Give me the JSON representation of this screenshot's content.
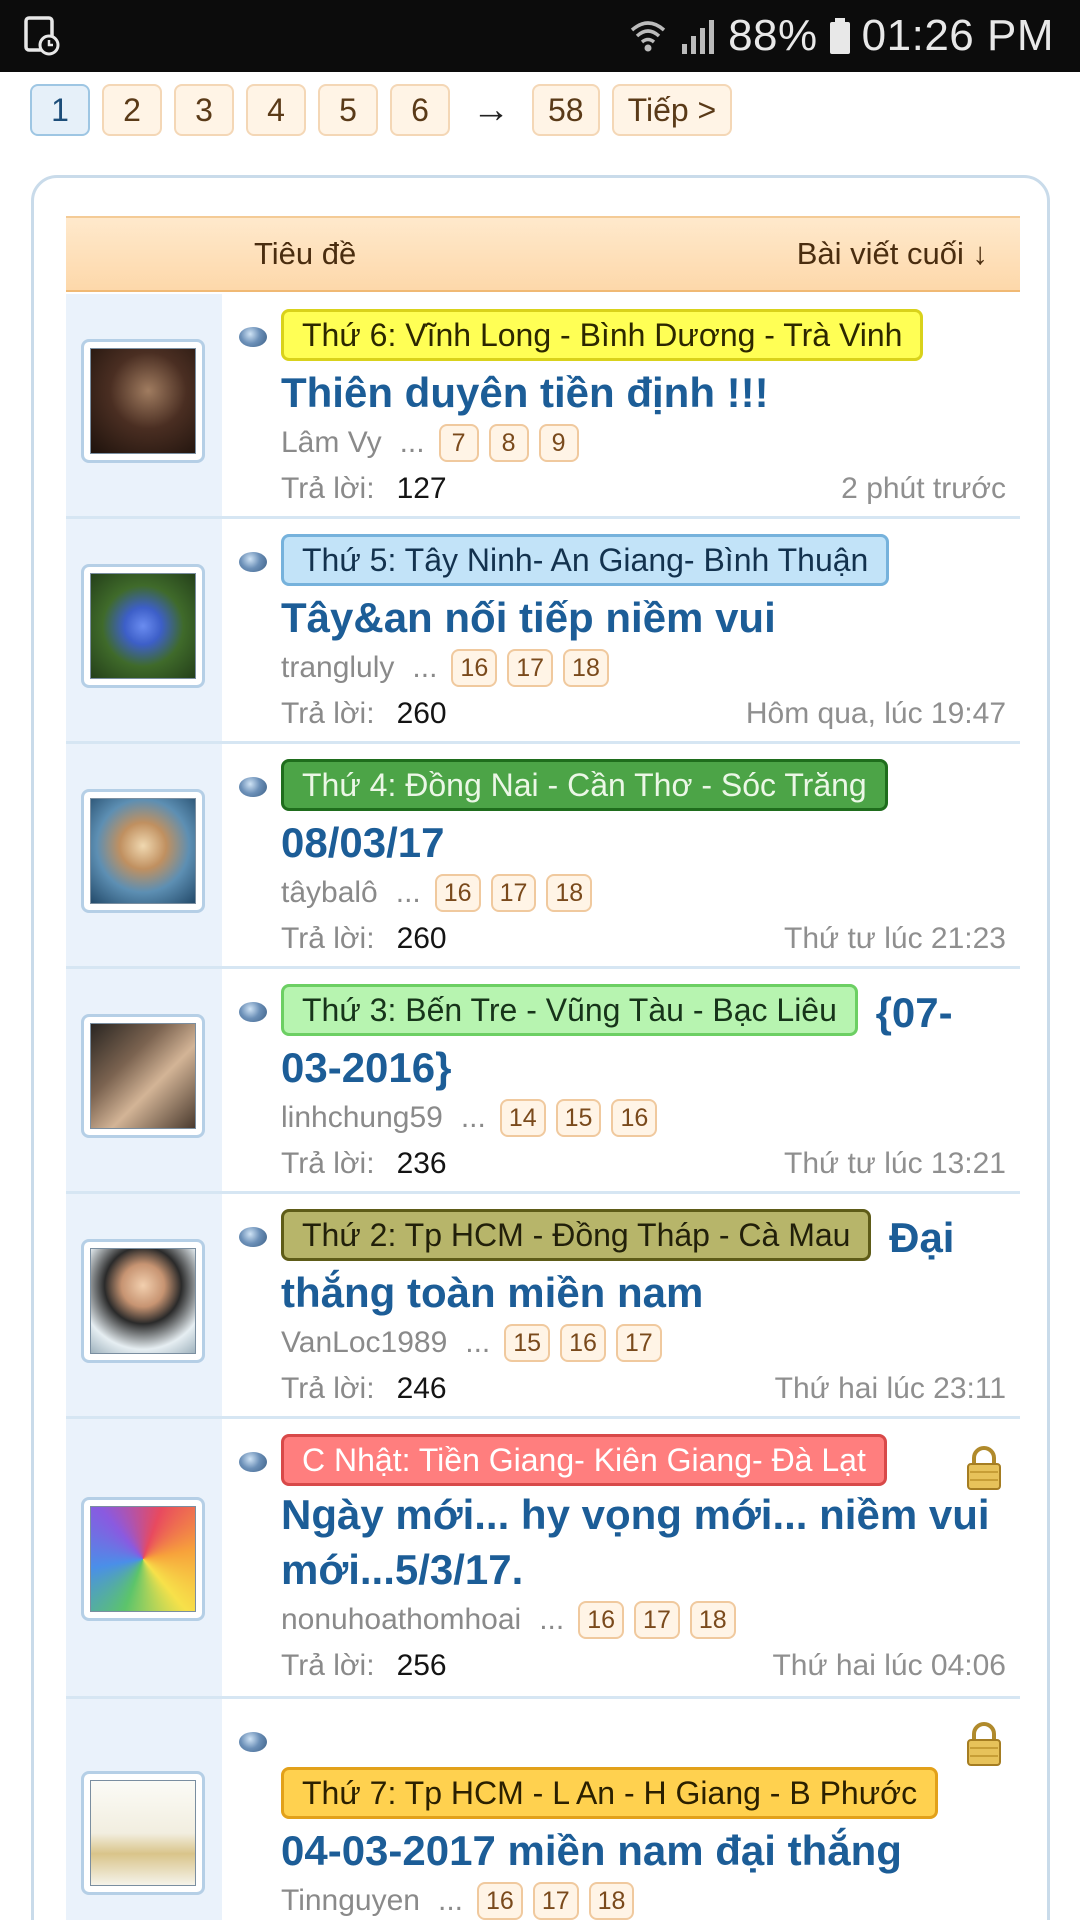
{
  "status_bar": {
    "battery": "88%",
    "time": "01:26 PM",
    "icons": [
      "screen-record-icon",
      "wifi-icon",
      "signal-icon",
      "battery-icon"
    ]
  },
  "pagination": {
    "pages": [
      "1",
      "2",
      "3",
      "4",
      "5",
      "6"
    ],
    "current": "1",
    "arrow": "→",
    "last": "58",
    "next": "Tiếp >"
  },
  "table_header": {
    "title": "Tiêu đề",
    "last_post": "Bài viết cuối ↓"
  },
  "reply_label": "Trả lời:",
  "threads": [
    {
      "prefix": "Thứ 6: Vĩnh Long - Bình Dương - Trà Vinh",
      "prefix_color": "yellow",
      "title": "Thiên duyên tiền định !!!",
      "author": "Lâm Vy",
      "pages": [
        "7",
        "8",
        "9"
      ],
      "replies": "127",
      "last": "2 phút trước",
      "locked": false
    },
    {
      "prefix": "Thứ 5: Tây Ninh- An Giang- Bình Thuận",
      "prefix_color": "light-blue",
      "title": "Tây&an nối tiếp niềm vui",
      "author": "trangluly",
      "pages": [
        "16",
        "17",
        "18"
      ],
      "replies": "260",
      "last": "Hôm qua, lúc 19:47",
      "locked": false
    },
    {
      "prefix": "Thứ 4: Đồng Nai - Cần Thơ - Sóc Trăng",
      "prefix_color": "green",
      "title": "08/03/17",
      "author": "tâybalô",
      "pages": [
        "16",
        "17",
        "18"
      ],
      "replies": "260",
      "last": "Thứ tư lúc 21:23",
      "locked": false
    },
    {
      "prefix": "Thứ 3: Bến Tre - Vũng Tàu - Bạc Liêu",
      "prefix_color": "light-green",
      "title": "{07-03-2016}",
      "author": "linhchung59",
      "pages": [
        "14",
        "15",
        "16"
      ],
      "replies": "236",
      "last": "Thứ tư lúc 13:21",
      "locked": false
    },
    {
      "prefix": "Thứ 2: Tp HCM - Đồng Tháp - Cà Mau",
      "prefix_color": "olive",
      "title": "Đại thắng toàn miền nam",
      "author": "VanLoc1989",
      "pages": [
        "15",
        "16",
        "17"
      ],
      "replies": "246",
      "last": "Thứ hai lúc 23:11",
      "locked": false
    },
    {
      "prefix": "C Nhật: Tiền Giang- Kiên Giang- Đà Lạt",
      "prefix_color": "red",
      "title": "Ngày mới... hy vọng mới... niềm vui mới...5/3/17.",
      "author": "nonuhoathomhoai",
      "pages": [
        "16",
        "17",
        "18"
      ],
      "replies": "256",
      "last": "Thứ hai lúc 04:06",
      "locked": true
    },
    {
      "prefix": "Thứ 7: Tp HCM - L An - H Giang - B Phước",
      "prefix_color": "orange",
      "title": "04-03-2017 miền nam đại thắng",
      "author": "Tinnguyen",
      "pages": [
        "16",
        "17",
        "18"
      ],
      "locked": true
    }
  ]
}
